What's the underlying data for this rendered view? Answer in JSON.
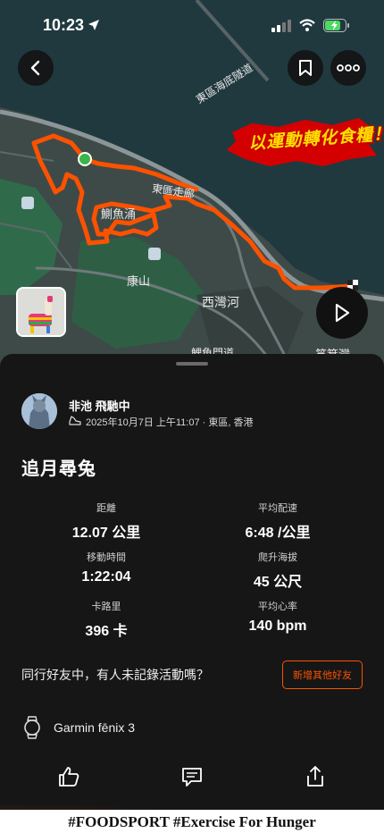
{
  "status_bar": {
    "time": "10:23"
  },
  "map": {
    "labels": {
      "tunnel": "東區海底隧道",
      "corridor": "東區走廊",
      "quarry_bay": "鰂魚涌",
      "kornhill": "康山",
      "sai_wan_ho": "西灣河",
      "shau_kei_wan": "筲箕灣",
      "bottom_partial": "鯉魚門道"
    },
    "route_color": "#fc5200"
  },
  "banner": {
    "text": "以運動轉化食糧！"
  },
  "athlete": {
    "name": "非池 飛馳中",
    "meta": "2025年10月7日 上午11:07 · 東區, 香港"
  },
  "activity": {
    "title": "追月尋兔",
    "stats": {
      "distance": {
        "label": "距離",
        "value": "12.07 公里"
      },
      "pace": {
        "label": "平均配速",
        "value": "6:48 /公里"
      },
      "moving_time": {
        "label": "移動時間",
        "value": "1:22:04"
      },
      "elevation": {
        "label": "爬升海拔",
        "value": "45 公尺"
      },
      "calories": {
        "label": "卡路里",
        "value": "396 卡"
      },
      "heart_rate": {
        "label": "平均心率",
        "value": "140 bpm"
      }
    }
  },
  "friends_prompt": {
    "text": "同行好友中，有人未記錄活動嗎？",
    "button": "新增其他好友"
  },
  "device": {
    "name": "Garmin fēnix 3"
  },
  "caption": "#FOODSPORT #Exercise For Hunger",
  "accent_color": "#fc5200"
}
